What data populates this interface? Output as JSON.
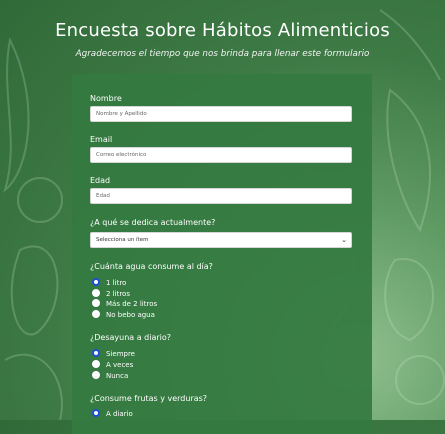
{
  "page": {
    "title": "Encuesta sobre Hábitos Alimenticios",
    "subtitle": "Agradecemos el tiempo que nos brinda para llenar este formulario"
  },
  "form": {
    "name": {
      "label": "Nombre",
      "placeholder": "Nombre y Apellido"
    },
    "email": {
      "label": "Email",
      "placeholder": "Correo electrónico"
    },
    "age": {
      "label": "Edad",
      "placeholder": "Edad"
    },
    "occupation": {
      "label": "¿A qué se dedica actualmente?",
      "selected": "Selecciona un ítem"
    },
    "water": {
      "label": "¿Cuánta agua consume al día?",
      "options": [
        "1 litro",
        "2 litros",
        "Más de 2 litros",
        "No bebo agua"
      ],
      "selected_index": 0
    },
    "breakfast": {
      "label": "¿Desayuna a diario?",
      "options": [
        "Siempre",
        "A veces",
        "Nunca"
      ],
      "selected_index": 0
    },
    "fruits": {
      "label": "¿Consume frutas y verduras?",
      "options": [
        "A diario"
      ],
      "selected_index": 0
    }
  },
  "colors": {
    "background": "#3e7a45",
    "card": "#347a40",
    "radio_checked": "#1a4fd6"
  }
}
